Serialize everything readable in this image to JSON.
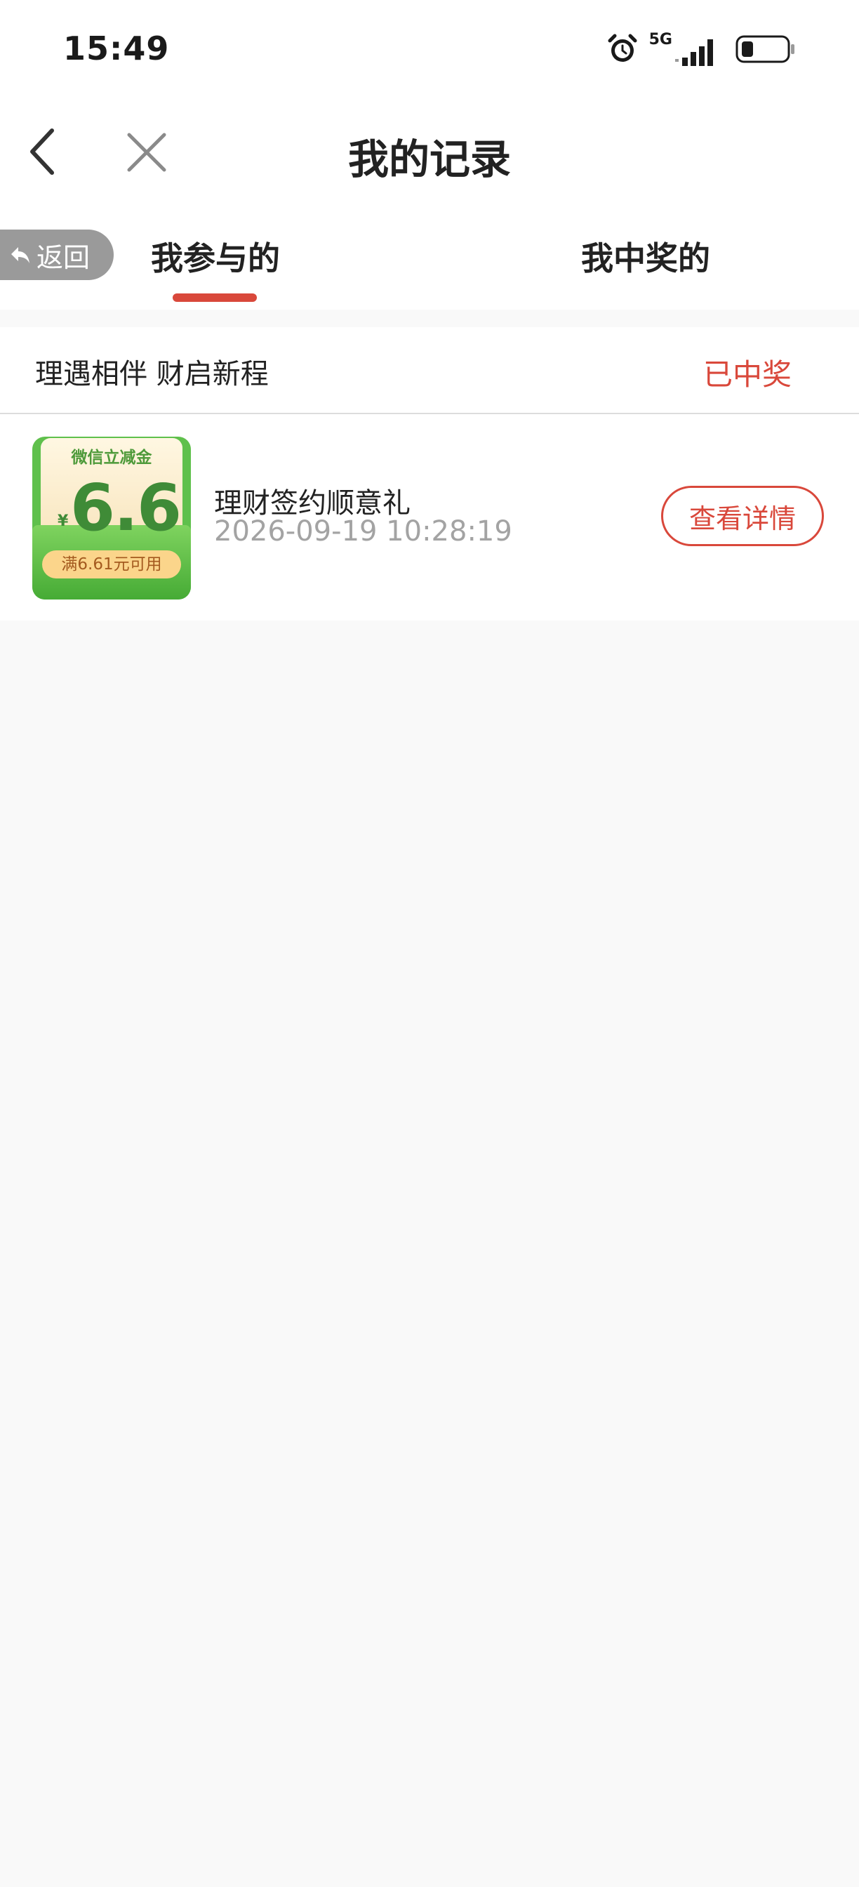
{
  "status_bar": {
    "time": "15:49",
    "network": "5G"
  },
  "nav": {
    "title": "我的记录"
  },
  "tabs": {
    "back_label": "返回",
    "items": [
      {
        "label": "我参与的",
        "active": true
      },
      {
        "label": "我中奖的",
        "active": false
      }
    ]
  },
  "record": {
    "activity_title": "理遇相伴 财启新程",
    "status": "已中奖",
    "voucher": {
      "label": "微信立减金",
      "currency": "¥",
      "amount": "6.6",
      "condition": "满6.61元可用"
    },
    "prize_name": "理财签约顺意礼",
    "timestamp": "2026-09-19 10:28:19",
    "detail_button": "查看详情"
  },
  "colors": {
    "accent": "#d9483b",
    "voucher_green": "#5fc04c",
    "background": "#f9f9f9"
  }
}
